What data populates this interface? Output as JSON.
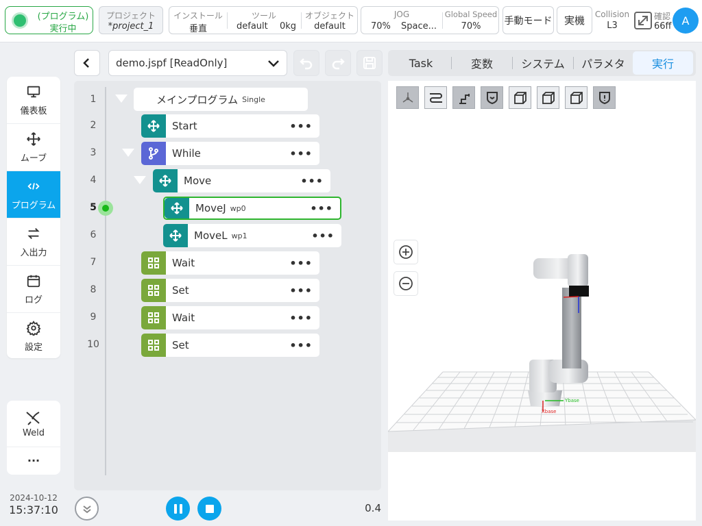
{
  "topbar": {
    "status": {
      "line1": "(プログラム)",
      "line2": "実行中"
    },
    "project": {
      "label": "プロジェクト",
      "value": "*project_1"
    },
    "install": {
      "label": "インストール",
      "value": "垂直"
    },
    "tool": {
      "label": "ツール",
      "name": "default",
      "weight": "0kg"
    },
    "object": {
      "label": "オブジェクト",
      "value": "default"
    },
    "jog": {
      "label": "JOG",
      "percent": "70%",
      "frame": "Space..."
    },
    "global_speed": {
      "label": "Global Speed",
      "value": "70%"
    },
    "manual_mode": "手動モード",
    "real_machine": "実機",
    "collision": {
      "label": "Collision",
      "value": "L3"
    },
    "confirm": {
      "label": "確認",
      "value": "66ff"
    },
    "avatar": "A"
  },
  "sidebar": {
    "items": [
      {
        "label": "儀表板",
        "icon": "monitor-icon"
      },
      {
        "label": "ムーブ",
        "icon": "move-arrows-icon"
      },
      {
        "label": "プログラム",
        "icon": "code-icon",
        "active": true
      },
      {
        "label": "入出力",
        "icon": "swap-arrows-icon"
      },
      {
        "label": "ログ",
        "icon": "calendar-icon"
      },
      {
        "label": "設定",
        "icon": "gear-icon"
      }
    ],
    "weld": {
      "label": "Weld",
      "icon": "weld-torch-icon"
    },
    "more": "..."
  },
  "datetime": {
    "date": "2024-10-12",
    "time": "15:37:10"
  },
  "program": {
    "file_name": "demo.jspf [ReadOnly]",
    "lines": [
      {
        "num": "1",
        "label": "メインプログラム",
        "sub": "Single"
      },
      {
        "num": "2",
        "label": "Start"
      },
      {
        "num": "3",
        "label": "While"
      },
      {
        "num": "4",
        "label": "Move"
      },
      {
        "num": "5",
        "label": "MoveJ",
        "sub": "wp0"
      },
      {
        "num": "6",
        "label": "MoveL",
        "sub": "wp1"
      },
      {
        "num": "7",
        "label": "Wait"
      },
      {
        "num": "8",
        "label": "Set"
      },
      {
        "num": "9",
        "label": "Wait"
      },
      {
        "num": "10",
        "label": "Set"
      }
    ],
    "more_glyph": "•••",
    "current_line": "5",
    "speed_readout": "0.4"
  },
  "tabs": [
    "Task",
    "変数",
    "システム",
    "パラメタ",
    "実行"
  ],
  "active_tab": "実行",
  "scene": {
    "axis_x": "Xbase",
    "axis_y": "Ybase"
  },
  "colors": {
    "accent": "#0ba5ec",
    "running_green": "#28a745",
    "node_teal": "#13918f",
    "node_purple": "#5b67d6",
    "node_green": "#7aa83b",
    "playback_blue": "#0ba5ec"
  }
}
